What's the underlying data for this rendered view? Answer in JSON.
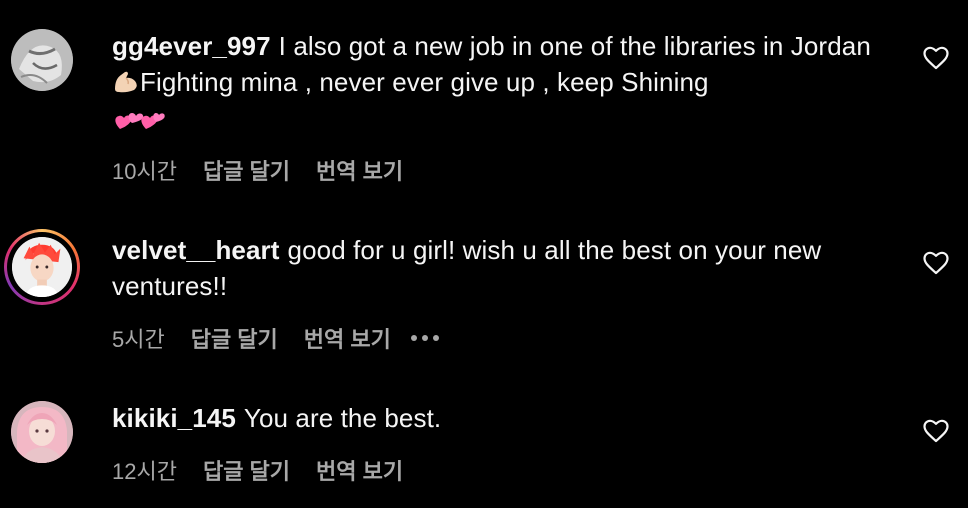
{
  "comments": [
    {
      "username": "gg4ever_997",
      "text_part1": "I also got a new job in one of the libraries in Jordan",
      "emoji1": "muscle-emoji",
      "text_part2": "Fighting mina , never ever give up , keep Shining",
      "emoji2": "two-hearts-emoji",
      "time": "10시간",
      "reply_label": "답글 달기",
      "translate_label": "번역 보기"
    },
    {
      "username": "velvet__heart",
      "text": "good for u girl! wish u all the best on your new ventures!!",
      "time": "5시간",
      "reply_label": "답글 달기",
      "translate_label": "번역 보기",
      "has_story": true
    },
    {
      "username": "kikiki_145",
      "text": "You are the best.",
      "time": "12시간",
      "reply_label": "답글 달기",
      "translate_label": "번역 보기"
    }
  ],
  "icons": {
    "like": "heart-outline-icon",
    "more": "more-options-icon"
  },
  "colors": {
    "background": "#000000",
    "text": "#f5f5f5",
    "meta": "#a8a8a8",
    "story_ring_start": "#fdc468",
    "story_ring_end": "#833ab4"
  }
}
